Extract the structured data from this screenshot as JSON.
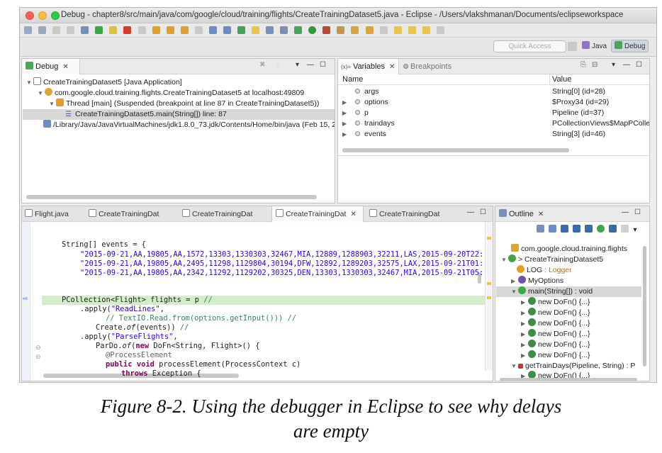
{
  "window": {
    "title": "Debug - chapter8/src/main/java/com/google/cloud/training/flights/CreateTrainingDataset5.java - Eclipse - /Users/vlakshmanan/Documents/eclipseworkspace"
  },
  "perspective": {
    "quick_access_placeholder": "Quick Access",
    "java_label": "Java",
    "debug_label": "Debug"
  },
  "debug_view": {
    "tab_label": "Debug",
    "items": [
      "CreateTrainingDataset5 [Java Application]",
      "com.google.cloud.training.flights.CreateTrainingDataset5 at localhost:49809",
      "Thread [main] (Suspended (breakpoint at line 87 in CreateTrainingDataset5))",
      "CreateTrainingDataset5.main(String[]) line: 87",
      "/Library/Java/JavaVirtualMachines/jdk1.8.0_73.jdk/Contents/Home/bin/java (Feb 15, 2"
    ]
  },
  "variables_view": {
    "tab_label": "Variables",
    "tab2_label": "Breakpoints",
    "col_name": "Name",
    "col_value": "Value",
    "rows": [
      {
        "name": "args",
        "value": "String[0]  (id=28)"
      },
      {
        "name": "options",
        "value": "$Proxy34  (id=29)"
      },
      {
        "name": "p",
        "value": "Pipeline  (id=37)"
      },
      {
        "name": "traindays",
        "value": "PCollectionViews$MapPCollec"
      },
      {
        "name": "events",
        "value": "String[3]  (id=46)"
      }
    ]
  },
  "editor": {
    "tabs": [
      "Flight.java",
      "CreateTrainingDat",
      "CreateTrainingDat",
      "CreateTrainingDat",
      "CreateTrainingDat"
    ],
    "code": {
      "l1a": "String[] events = {",
      "l2": "\"2015-09-21,AA,19805,AA,1572,13303,1330303,32467,MIA,12889,1288903,32211,LAS,2015-09-20T22:",
      "l3": "\"2015-09-21,AA,19805,AA,2495,11298,1129804,30194,DFW,12892,1289203,32575,LAX,2015-09-21T01:",
      "l4": "\"2015-09-21,AA,19805,AA,2342,11292,1129202,30325,DEN,13303,1330303,32467,MIA,2015-09-21T05:",
      "l5a": "PCollection<Flight> flights = p ",
      "l5b": "//",
      "l6a": ".apply(",
      "l6b": "\"ReadLines\"",
      "l6c": ",",
      "l7": "// TextIO.Read.from(options.getInput())) //",
      "l8a": "Create.",
      "l8b": "of",
      "l8c": "(events)) ",
      "l8d": "//",
      "l9a": ".apply(",
      "l9b": "\"ParseFlights\"",
      "l9c": ",",
      "l10a": "ParDo.",
      "l10b": "of",
      "l10c": "(",
      "l10d": "new",
      "l10e": " DoFn<String, Flight>() {",
      "l11": "@ProcessElement",
      "l12a": "public",
      "l12b": " ",
      "l12c": "void",
      "l12d": " processElement(ProcessContext c)",
      "l13a": "throws",
      "l13b": " Exception {"
    }
  },
  "outline_view": {
    "tab_label": "Outline",
    "items": [
      "com.google.cloud.training.flights",
      "> CreateTrainingDataset5",
      "LOG",
      ": Logger",
      "MyOptions",
      "main(String[]) : void",
      "new DoFn() {...}",
      "new DoFn() {...}",
      "new DoFn() {...}",
      "new DoFn() {...}",
      "new DoFn() {...}",
      "new DoFn() {...}",
      "getTrainDays(Pipeline, String) : P",
      "new DoFn() {...}"
    ]
  },
  "caption": {
    "line1": "Figure 8-2. Using the debugger in Eclipse to see why delays",
    "line2": "are empty"
  },
  "colors": {
    "breakpoint_highlight": "#d4edc9",
    "selected_row": "#d8d8d8",
    "keyword": "#7f0055",
    "string": "#2a00ff",
    "comment": "#3f7f5f"
  }
}
